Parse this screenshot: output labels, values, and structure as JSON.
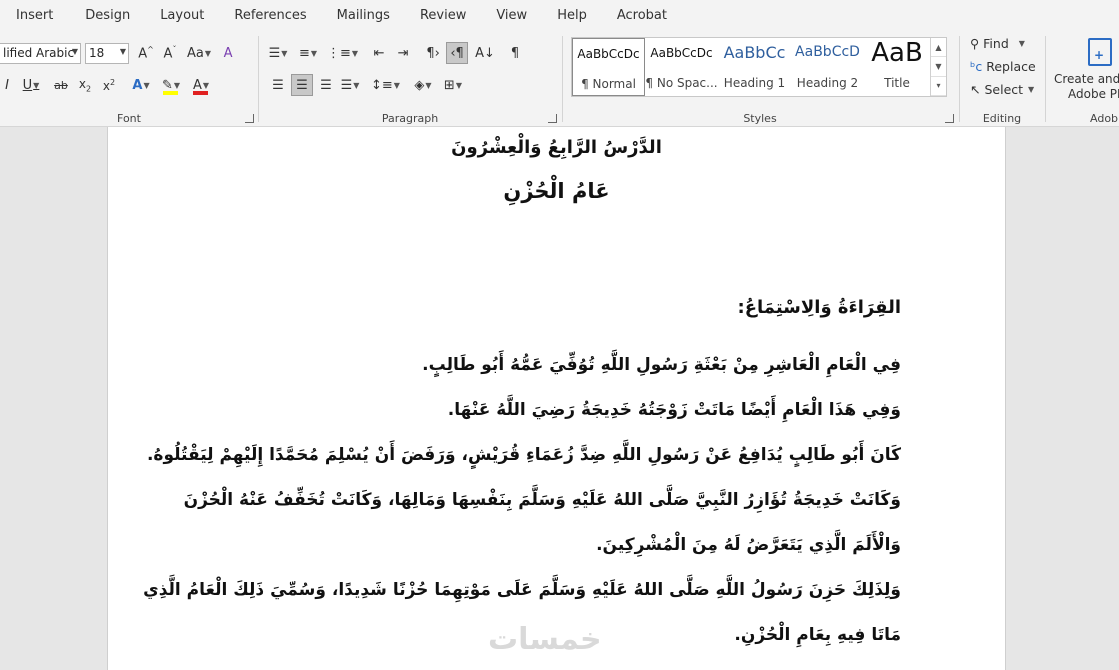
{
  "tabs": [
    "Insert",
    "Design",
    "Layout",
    "References",
    "Mailings",
    "Review",
    "View",
    "Help",
    "Acrobat"
  ],
  "font": {
    "name": "lified Arabic",
    "size": "18",
    "group_label": "Font",
    "highlight_color": "#ffff00",
    "font_color": "#e02020"
  },
  "paragraph": {
    "group_label": "Paragraph"
  },
  "styles": {
    "group_label": "Styles",
    "items": [
      {
        "preview": "AaBbCcDc",
        "name": "¶ Normal"
      },
      {
        "preview": "AaBbCcDc",
        "name": "¶ No Spac..."
      },
      {
        "preview": "AaBbCc",
        "name": "Heading 1"
      },
      {
        "preview": "AaBbCcD",
        "name": "Heading 2"
      },
      {
        "preview": "AaB",
        "name": "Title"
      }
    ]
  },
  "editing": {
    "group_label": "Editing",
    "find": "Find",
    "replace": "Replace",
    "select": "Select"
  },
  "adobe": {
    "line1": "Create and S",
    "line2": "Adobe PD",
    "group_label": "Adob"
  },
  "document": {
    "title": "الدَّرْسُ الرَّابِعُ وَالْعِشْرُونَ",
    "subtitle": "عَامُ الْحُزْنِ",
    "section_heading": "القِرَاءَةُ وَالِاسْتِمَاعُ:",
    "lines": [
      "فِي الْعَامِ الْعَاشِرِ مِنْ بَعْثَةِ رَسُولِ اللَّهِ تُوُفِّيَ عَمُّهُ أَبُو طَالِبٍ.",
      "وَفِي هَذَا الْعَامِ أَيْضًا مَاتَتْ زَوْجَتُهُ خَدِيجَةُ رَضِيَ اللَّهُ عَنْهَا.",
      "كَانَ أَبُو طَالِبٍ يُدَافِعُ عَنْ رَسُولِ اللَّهِ ضِدَّ زُعَمَاءِ قُرَيْشٍ، وَرَفَضَ أَنْ يُسْلِمَ مُحَمَّدًا إِلَيْهِمْ لِيَقْتُلُوهُ.",
      "وَكَانَتْ خَدِيجَةُ تُؤَازِرُ النَّبِيَّ صَلَّى اللهُ عَلَيْهِ وَسَلَّمَ بِنَفْسِهَا وَمَالِهَا، وَكَانَتْ تُخَفِّفُ عَنْهُ الْحُزْنَ",
      "وَالْأَلَمَ الَّذِي يَتَعَرَّضُ لَهُ مِنَ الْمُشْرِكِينَ.",
      "وَلِذَلِكَ حَزِنَ رَسُولُ اللَّهِ صَلَّى اللهُ عَلَيْهِ وَسَلَّمَ عَلَى مَوْتِهِمَا حُزْنًا شَدِيدًا، وَسُمِّيَ ذَلِكَ الْعَامُ الَّذِي",
      "مَاتَا فِيهِ بِعَامِ الْحُزْنِ."
    ],
    "watermark": "خمسات"
  }
}
